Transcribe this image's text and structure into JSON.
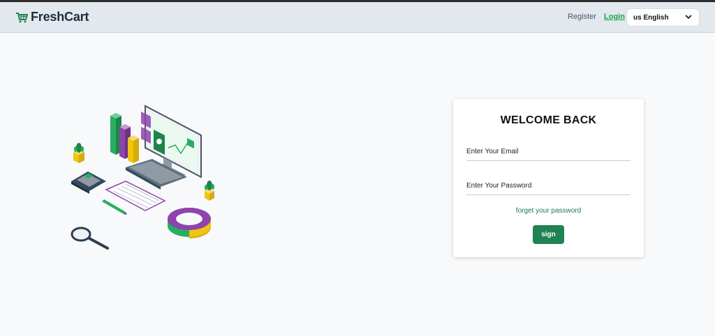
{
  "navbar": {
    "brand": "FreshCart",
    "register": "Register",
    "login": "Login",
    "language": "us English"
  },
  "icons": [
    "cart-icon",
    "chevron-down-icon"
  ],
  "colors": {
    "brand": "#1f8354",
    "login_link": "#16a34a",
    "navbar_bg": "#e2e8ee",
    "page_bg": "#f8f9fa"
  },
  "login_card": {
    "title": "WELCOME BACK",
    "email_placeholder": "Enter Your Email",
    "password_placeholder": "Enter Your Password",
    "forgot_link": "forget your password",
    "submit_label": "sign"
  }
}
